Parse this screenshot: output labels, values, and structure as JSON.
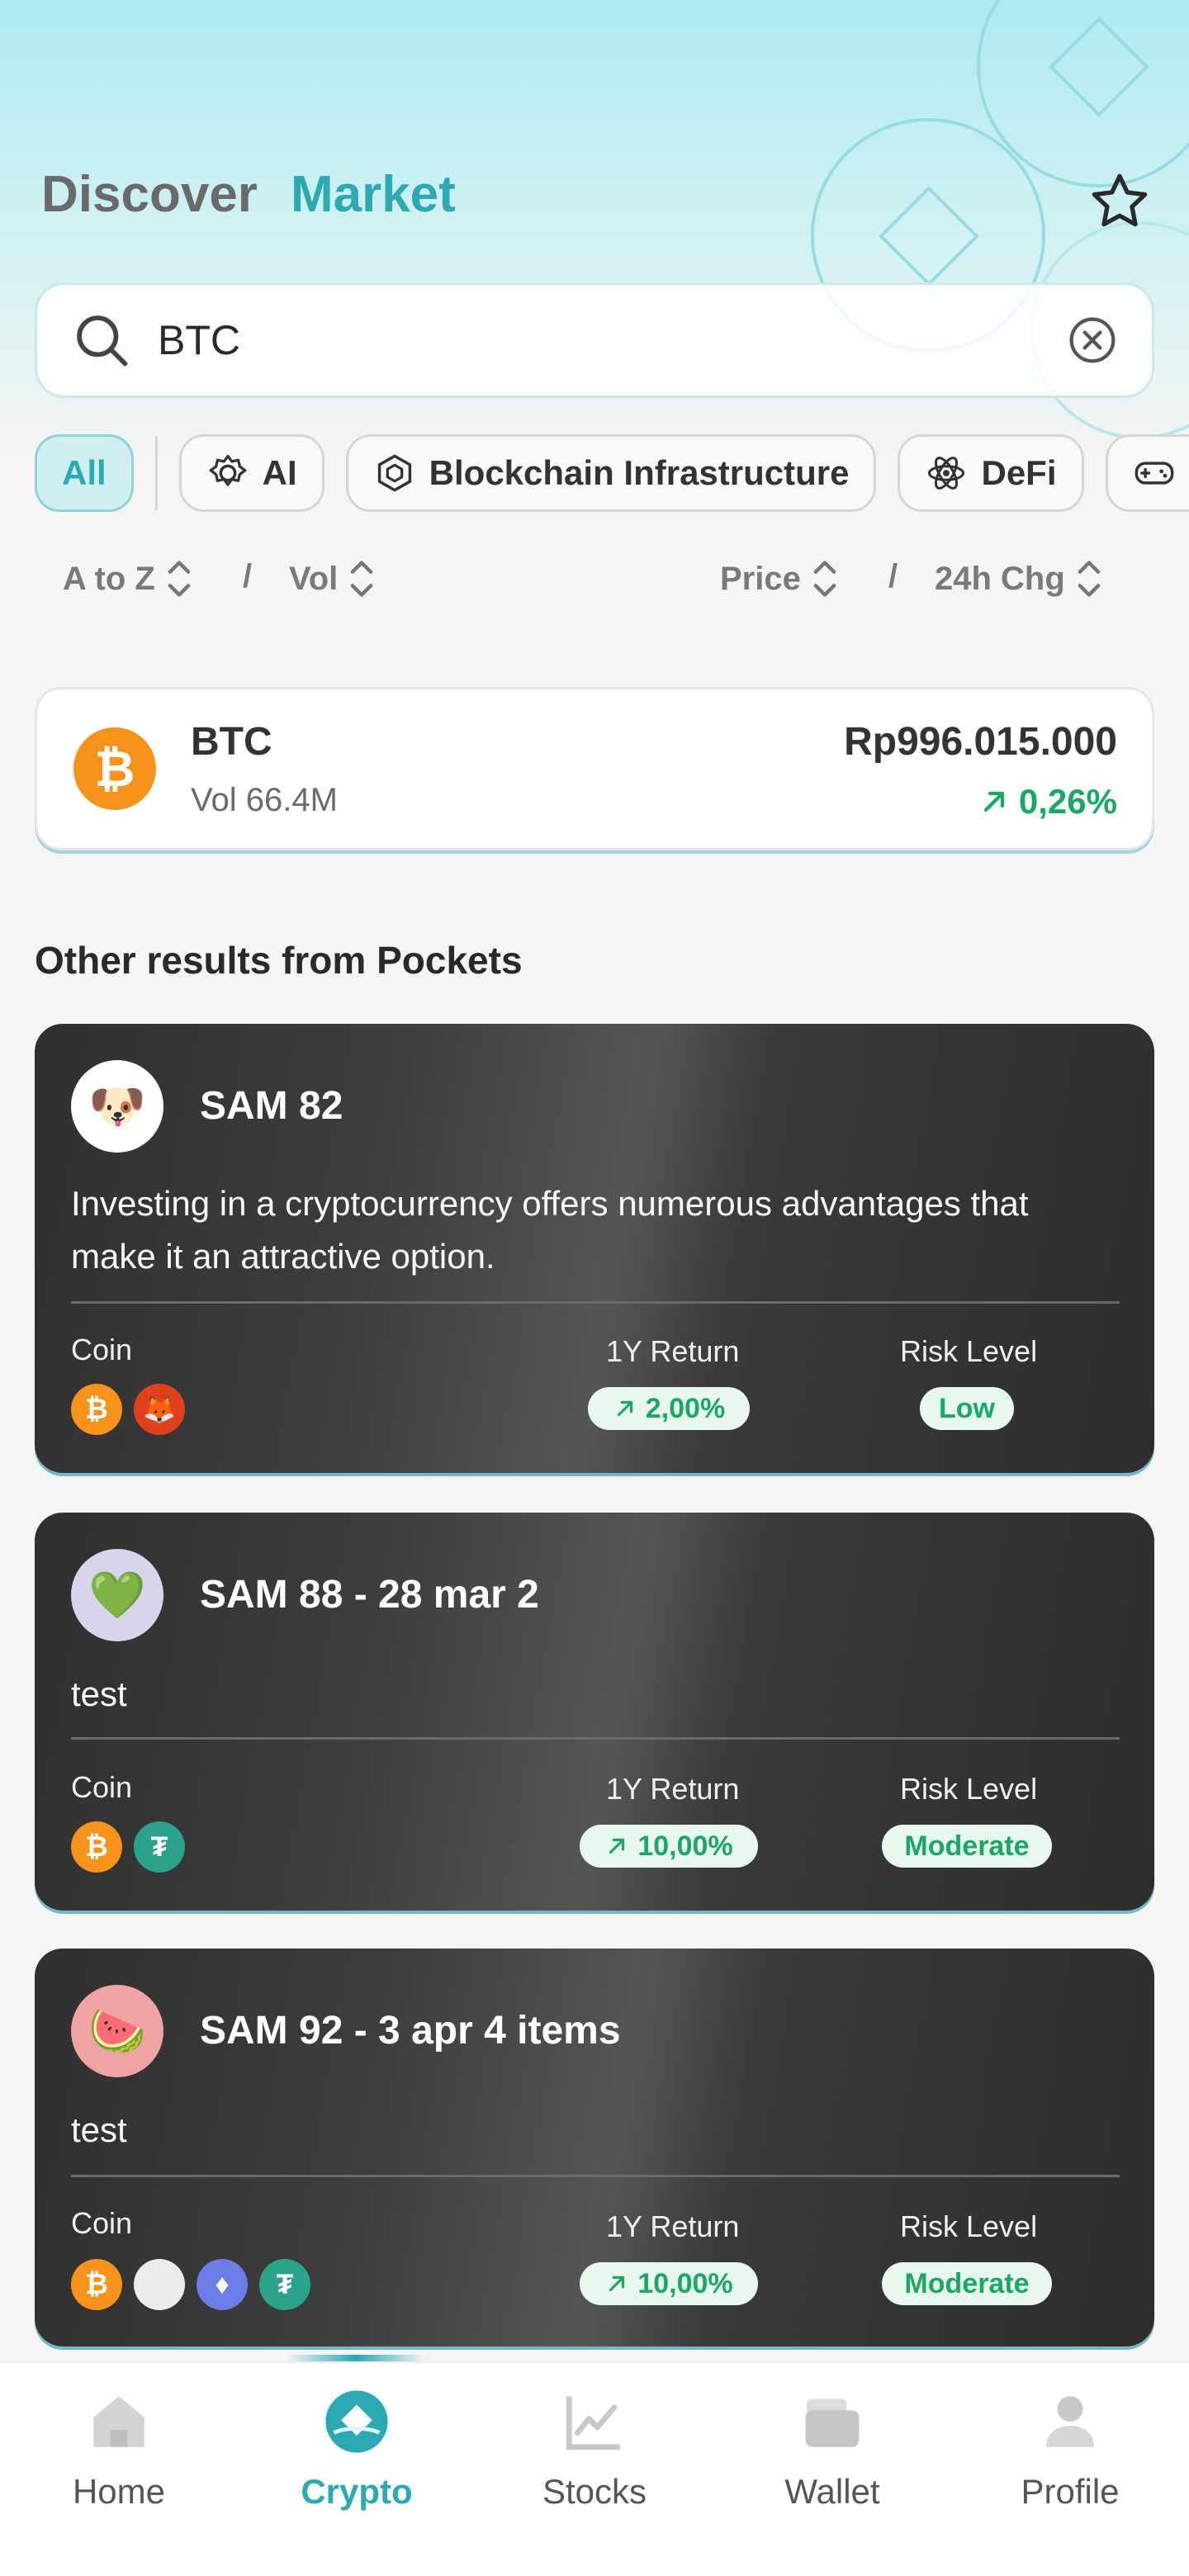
{
  "header": {
    "discover_label": "Discover",
    "market_label": "Market"
  },
  "search": {
    "value": "BTC"
  },
  "chips": [
    {
      "label": "All",
      "icon": "none",
      "active": true
    },
    {
      "label": "AI",
      "icon": "ai-chip-icon"
    },
    {
      "label": "Blockchain Infrastructure",
      "icon": "hexagon-icon"
    },
    {
      "label": "DeFi",
      "icon": "atom-icon"
    },
    {
      "label": "",
      "icon": "gamepad-icon"
    }
  ],
  "sort": {
    "a_to_z": "A to Z",
    "vol": "Vol",
    "price": "Price",
    "change": "24h Chg",
    "separator": "/"
  },
  "btc_result": {
    "symbol": "BTC",
    "volume": "Vol 66.4M",
    "price": "Rp996.015.000",
    "change": "0,26%",
    "logo": "₿"
  },
  "section_title": "Other results from Pockets",
  "labels": {
    "coin": "Coin",
    "return": "1Y Return",
    "risk": "Risk Level"
  },
  "pockets": [
    {
      "name": "SAM 82",
      "avatar": "🐶",
      "avatar_bg": "#ffffff",
      "description": "Investing in a cryptocurrency offers numerous advantages that make it an attractive option.",
      "return": "2,00%",
      "risk": "Low",
      "coins": [
        "btc",
        "shib"
      ]
    },
    {
      "name": "SAM 88 - 28 mar 2",
      "avatar": "💚",
      "avatar_bg": "#d9d4ec",
      "description": "test",
      "return": "10,00%",
      "risk": "Moderate",
      "coins": [
        "btc",
        "usdt"
      ]
    },
    {
      "name": "SAM 92 - 3 apr 4 items",
      "avatar": "🍉",
      "avatar_bg": "#f0a3a3",
      "description": "test",
      "return": "10,00%",
      "risk": "Moderate",
      "coins": [
        "btc",
        "blank",
        "eth",
        "usdt"
      ]
    }
  ],
  "nav": [
    {
      "label": "Home",
      "icon": "home-icon"
    },
    {
      "label": "Crypto",
      "icon": "crypto-icon",
      "active": true
    },
    {
      "label": "Stocks",
      "icon": "chart-icon"
    },
    {
      "label": "Wallet",
      "icon": "wallet-icon"
    },
    {
      "label": "Profile",
      "icon": "profile-icon"
    }
  ],
  "colors": {
    "accent": "#2ca9b3",
    "positive": "#1aa865",
    "bitcoin": "#f7931a"
  }
}
